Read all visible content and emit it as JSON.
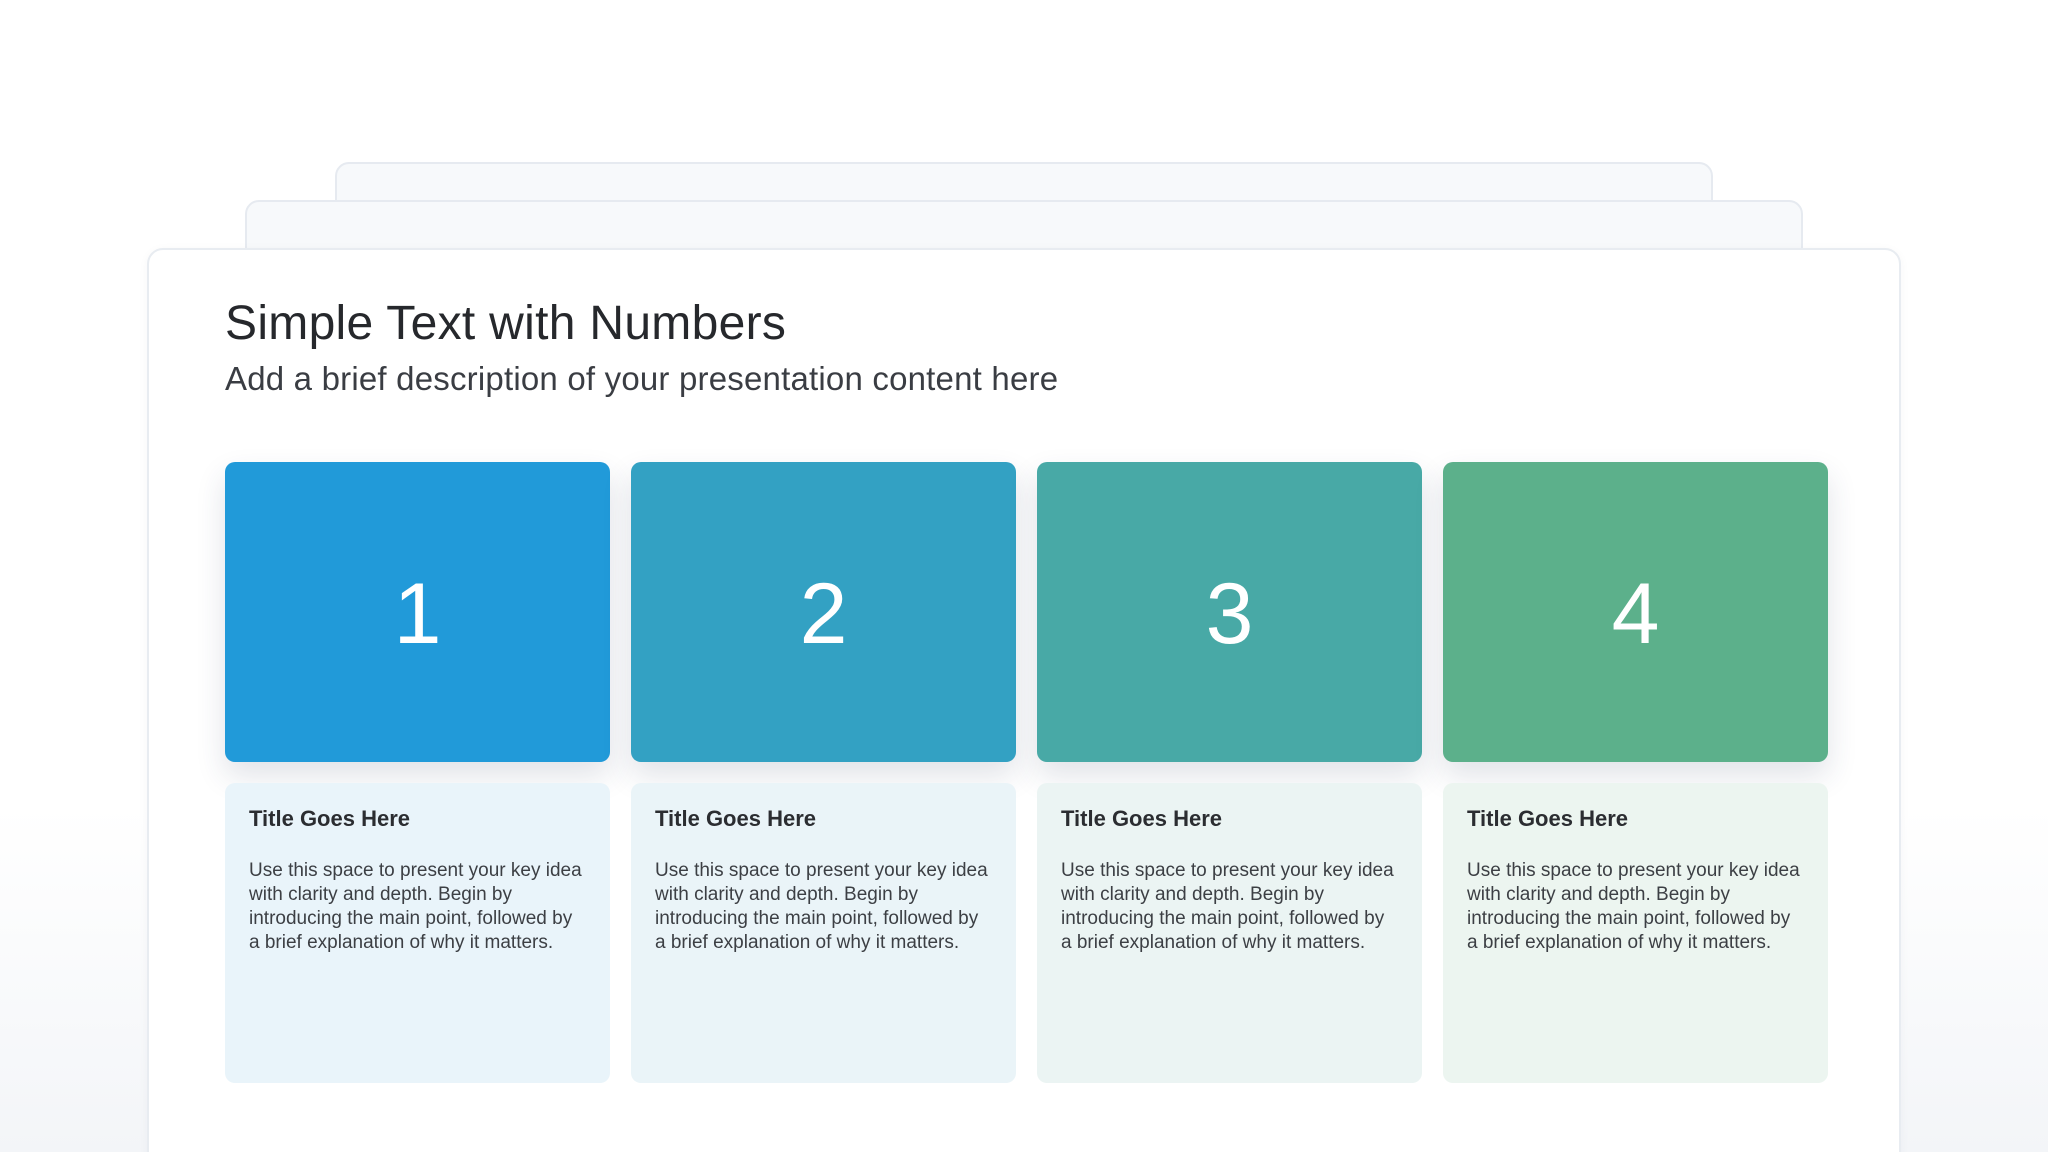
{
  "slide": {
    "title": "Simple Text with Numbers",
    "subtitle": "Add a brief description of your presentation content here"
  },
  "columns": [
    {
      "number": "1",
      "title": "Title Goes Here",
      "body": "Use this space to present your key idea with clarity and depth. Begin by introducing the main point, followed by a brief explanation of why it matters.",
      "tile_color": "#219ad9",
      "card_color": "#e9f4fa"
    },
    {
      "number": "2",
      "title": "Title Goes Here",
      "body": "Use this space to present your key idea with clarity and depth. Begin by introducing the main point, followed by a brief explanation of why it matters.",
      "tile_color": "#33a1c3",
      "card_color": "#eaf4f8"
    },
    {
      "number": "3",
      "title": "Title Goes Here",
      "body": "Use this space to present your key idea with clarity and depth. Begin by introducing the main point, followed by a brief explanation of why it matters.",
      "tile_color": "#48a9a6",
      "card_color": "#ebf4f3"
    },
    {
      "number": "4",
      "title": "Title Goes Here",
      "body": "Use this space to present your key idea with clarity and depth. Begin by introducing the main point, followed by a brief explanation of why it matters.",
      "tile_color": "#5cb08b",
      "card_color": "#ecf5f0"
    }
  ]
}
